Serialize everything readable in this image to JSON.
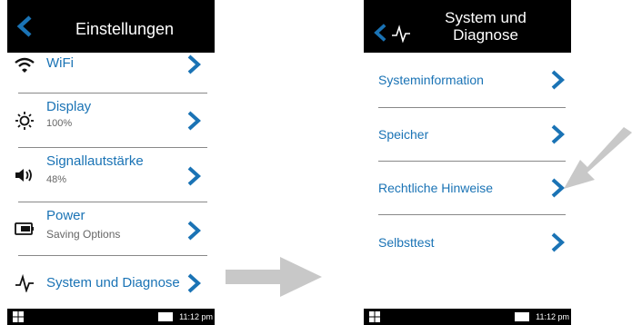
{
  "screen1": {
    "title": "Einstellungen",
    "items": [
      {
        "label": "WiFi",
        "sub": "",
        "icon": "wifi-icon"
      },
      {
        "label": "Display",
        "sub": "100%",
        "icon": "brightness-icon"
      },
      {
        "label": "Signallautstärke",
        "sub": "48%",
        "icon": "speaker-icon"
      },
      {
        "label": "Power",
        "sub": "Saving Options",
        "icon": "battery-icon"
      },
      {
        "label": "System und Diagnose",
        "sub": "",
        "icon": "pulse-icon"
      }
    ],
    "time": "11:12 pm"
  },
  "screen2": {
    "title_line1": "System und",
    "title_line2": "Diagnose",
    "items": [
      {
        "label": "Systeminformation"
      },
      {
        "label": "Speicher"
      },
      {
        "label": "Rechtliche Hinweise"
      },
      {
        "label": "Selbsttest"
      }
    ],
    "time": "11:12 pm"
  },
  "colors": {
    "accent": "#1a73b5",
    "arrow": "#c8c8c8",
    "header": "#000000"
  }
}
